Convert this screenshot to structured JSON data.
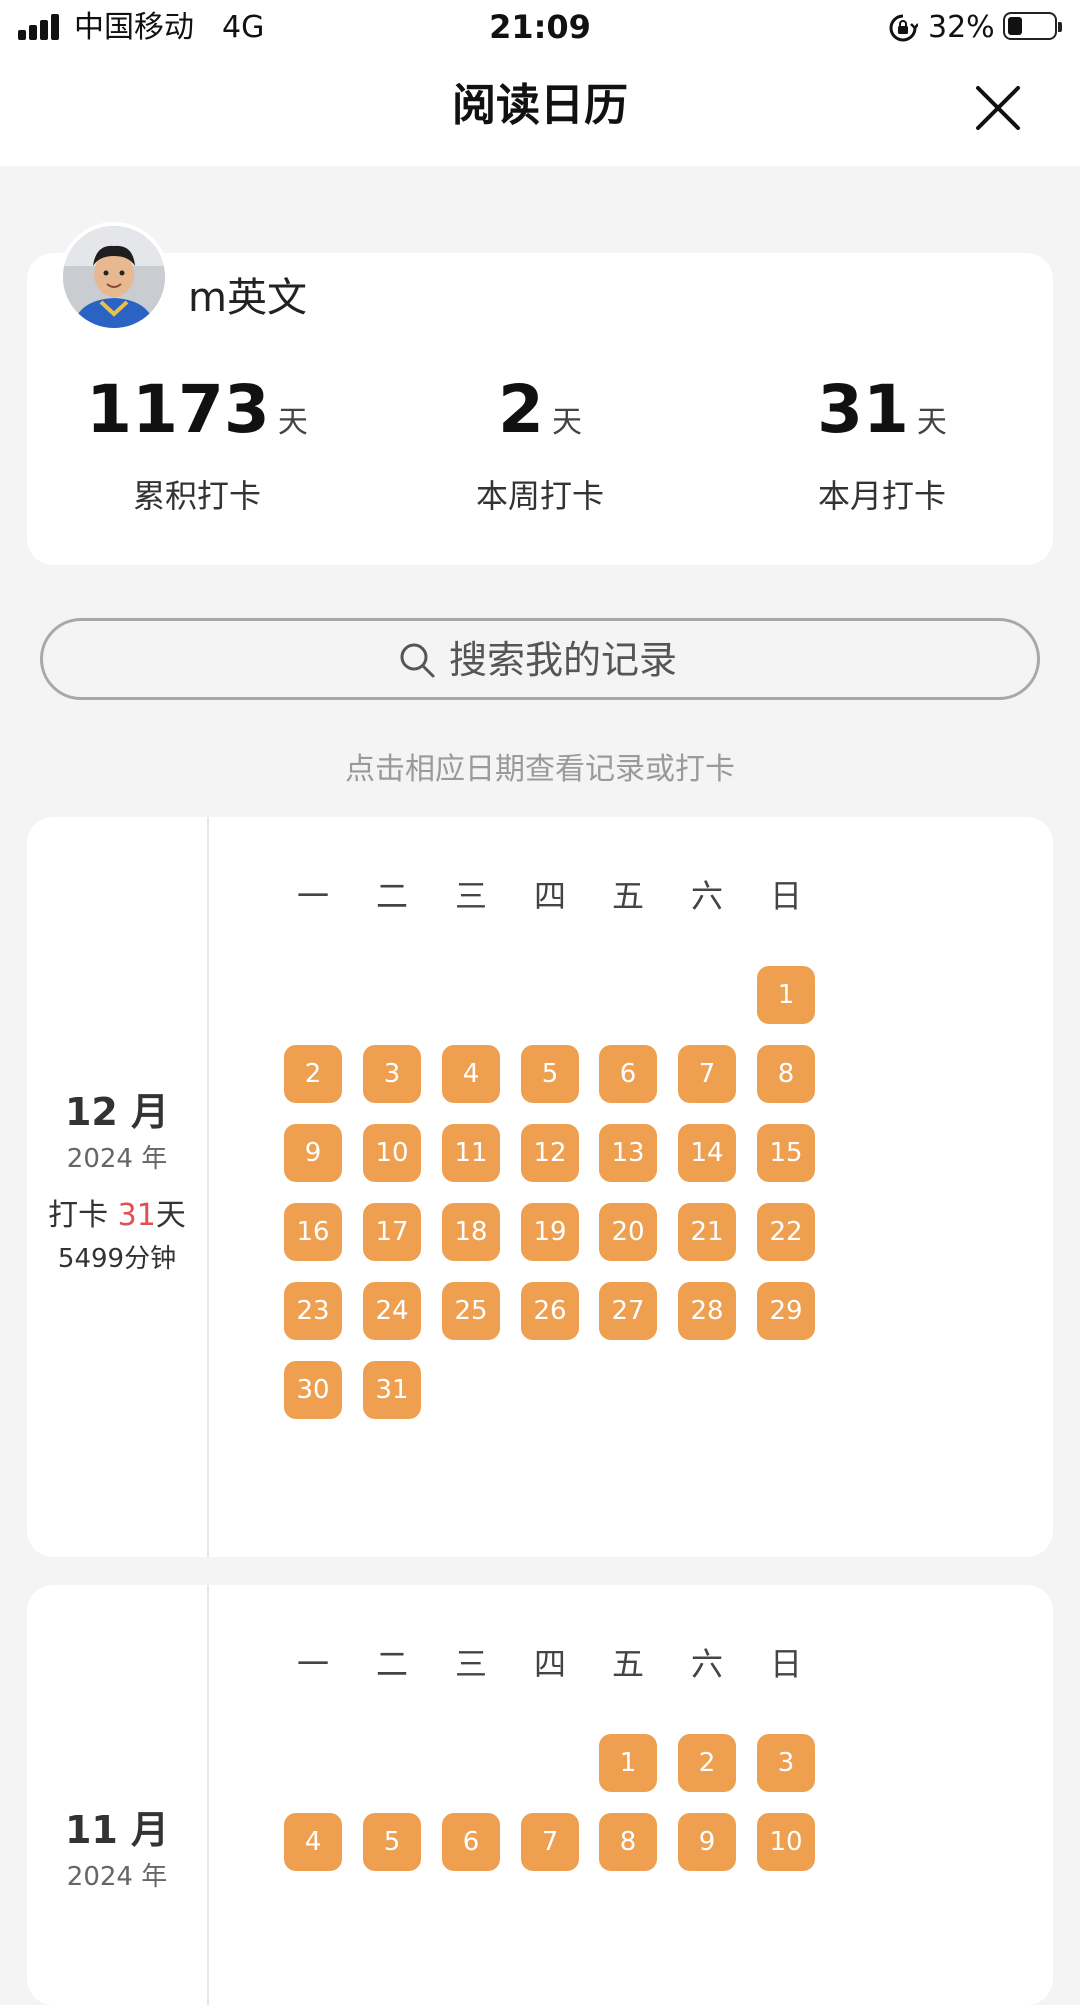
{
  "status_bar": {
    "carrier": "中国移动",
    "network": "4G",
    "time": "21:09",
    "battery_percent": "32%",
    "battery_level": 0.32,
    "icons": [
      "signal-icon",
      "rotation-lock-icon",
      "battery-icon"
    ]
  },
  "header": {
    "title": "阅读日历",
    "close_icon": "close-icon"
  },
  "profile": {
    "name": "m英文",
    "avatar_icon": "avatar-photo"
  },
  "stats": [
    {
      "value": "1173",
      "unit": "天",
      "label": "累积打卡"
    },
    {
      "value": "2",
      "unit": "天",
      "label": "本周打卡"
    },
    {
      "value": "31",
      "unit": "天",
      "label": "本月打卡"
    }
  ],
  "search": {
    "placeholder": "搜索我的记录",
    "icon": "search-icon"
  },
  "hint": "点击相应日期查看记录或打卡",
  "weekdays": [
    "一",
    "二",
    "三",
    "四",
    "五",
    "六",
    "日"
  ],
  "colors": {
    "accent": "#ee9f50",
    "highlight": "#e05050",
    "background": "#f4f4f4"
  },
  "months": [
    {
      "month": "12 月",
      "year": "2024 年",
      "checkin_prefix": "打卡 ",
      "checkin_days": "31",
      "checkin_suffix": "天",
      "minutes": "5499分钟",
      "first_weekday": 7,
      "days_shown": 31
    },
    {
      "month": "11 月",
      "year": "2024 年",
      "first_weekday": 5,
      "days_shown": 10
    }
  ]
}
